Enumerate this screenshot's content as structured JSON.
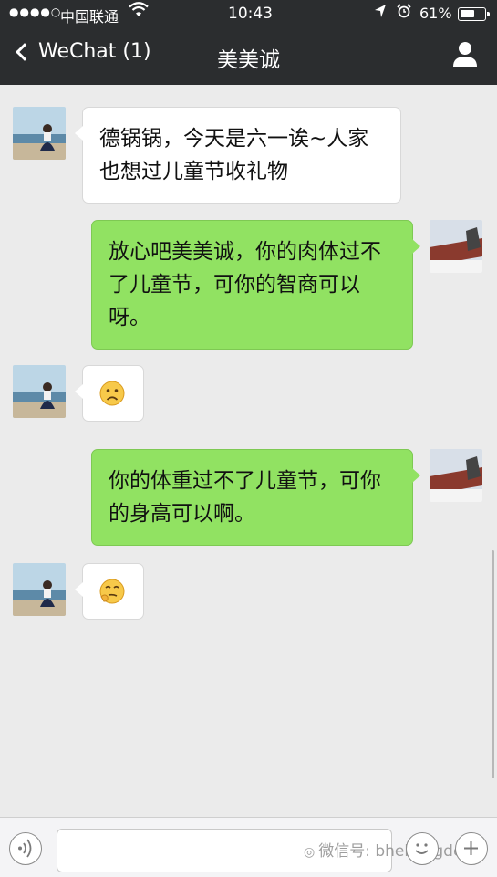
{
  "status": {
    "signal": "●●●●○",
    "carrier": "中国联通",
    "time": "10:43",
    "battery_text": "61%",
    "battery_level": 0.61
  },
  "nav": {
    "back_label": "WeChat (1)",
    "title": "美美诚"
  },
  "messages": [
    {
      "side": "in",
      "type": "text",
      "text": "德锅锅，今天是六一诶~人家也想过儿童节收礼物"
    },
    {
      "side": "out",
      "type": "text",
      "text": "放心吧美美诚，你的肉体过不了儿童节，可你的智商可以呀。"
    },
    {
      "side": "in",
      "type": "emoji",
      "emoji": "frown-emoji-icon"
    },
    {
      "side": "out",
      "type": "text",
      "text": "你的体重过不了儿童节，可你的身高可以啊。"
    },
    {
      "side": "in",
      "type": "emoji",
      "emoji": "thinking-emoji-icon"
    }
  ],
  "input": {
    "watermark": "微信号: bhehengde"
  },
  "colors": {
    "nav_bg": "#2b2d2f",
    "chat_bg": "#ebebeb",
    "bubble_out": "#91e262",
    "bubble_in": "#ffffff"
  }
}
